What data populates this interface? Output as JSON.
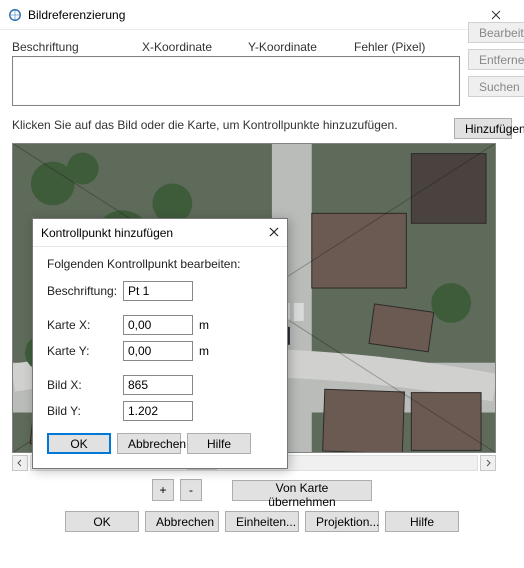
{
  "window": {
    "title": "Bildreferenzierung"
  },
  "columns": {
    "label": "Beschriftung",
    "x": "X-Koordinate",
    "y": "Y-Koordinate",
    "err": "Fehler (Pixel)"
  },
  "side": {
    "edit": "Bearbeiten...",
    "remove": "Entfernen",
    "search": "Suchen"
  },
  "instruction": "Klicken Sie auf das Bild oder die Karte, um Kontrollpunkte hinzuzufügen.",
  "add": "Hinzufügen",
  "zoom": {
    "plus": "+",
    "minus": "-",
    "take_from_map": "Von Karte übernehmen"
  },
  "bottom": {
    "ok": "OK",
    "cancel": "Abbrechen",
    "units": "Einheiten...",
    "projection": "Projektion...",
    "help": "Hilfe"
  },
  "modal": {
    "title": "Kontrollpunkt hinzufügen",
    "subtitle": "Folgenden Kontrollpunkt bearbeiten:",
    "label_label": "Beschriftung:",
    "label_value": "Pt 1",
    "mapx_label": "Karte X:",
    "mapx_value": "0,00",
    "mapy_label": "Karte Y:",
    "mapy_value": "0,00",
    "unit": "m",
    "imgx_label": "Bild X:",
    "imgx_value": "865",
    "imgy_label": "Bild Y:",
    "imgy_value": "1.202",
    "ok": "OK",
    "cancel": "Abbrechen",
    "help": "Hilfe"
  }
}
